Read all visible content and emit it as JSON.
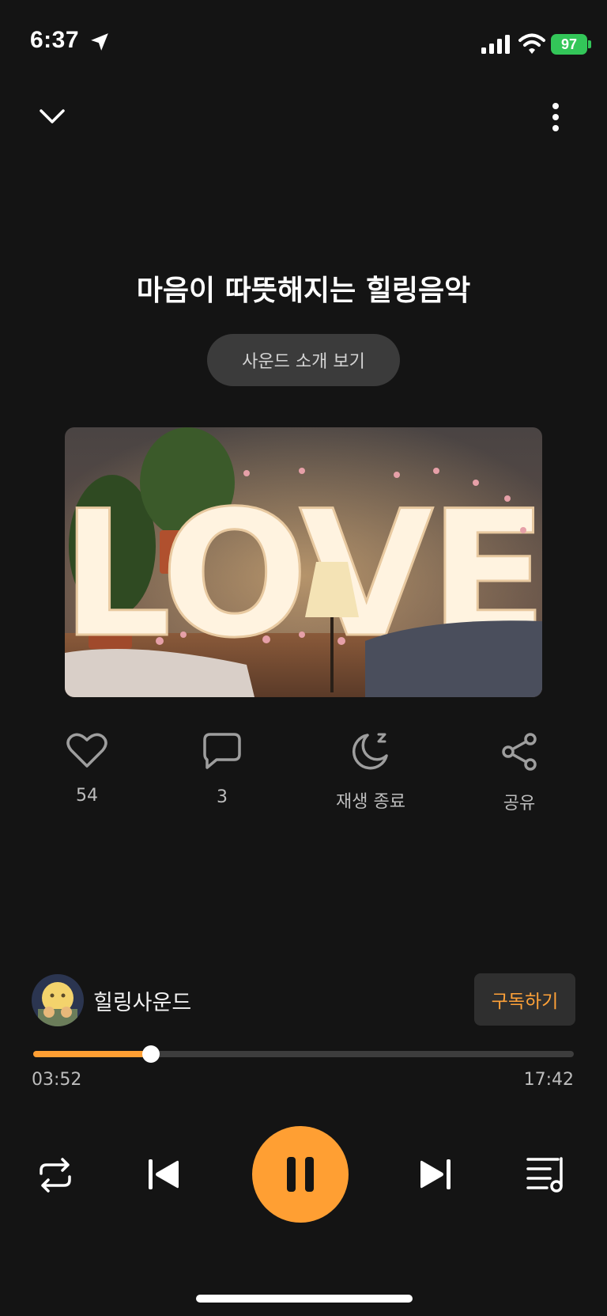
{
  "status": {
    "time": "6:37",
    "battery": "97"
  },
  "title": "마음이 따뜻해지는 힐링음악",
  "intro_button": "사운드 소개 보기",
  "cover": {
    "sign_text": "LOVE"
  },
  "actions": [
    {
      "icon": "heart-icon",
      "label": "54"
    },
    {
      "icon": "comment-icon",
      "label": "3"
    },
    {
      "icon": "sleep-timer-icon",
      "label": "재생 종료"
    },
    {
      "icon": "share-icon",
      "label": "공유"
    }
  ],
  "channel": {
    "name": "힐링사운드",
    "subscribe_label": "구독하기"
  },
  "progress": {
    "current": "03:52",
    "total": "17:42",
    "fraction": 0.218
  },
  "colors": {
    "accent": "#ff9f33",
    "background": "#141414",
    "battery": "#33c659"
  }
}
